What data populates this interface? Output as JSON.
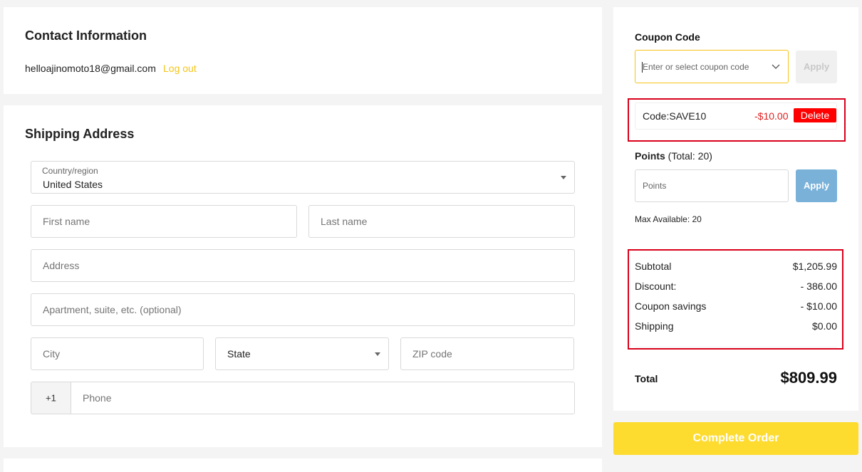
{
  "contact": {
    "title": "Contact Information",
    "email": "helloajinomoto18@gmail.com",
    "logout_label": "Log out"
  },
  "shipping": {
    "title": "Shipping Address",
    "country_label": "Country/region",
    "country_value": "United States",
    "first_name_placeholder": "First name",
    "last_name_placeholder": "Last name",
    "address_placeholder": "Address",
    "apartment_placeholder": "Apartment, suite, etc. (optional)",
    "city_placeholder": "City",
    "state_value": "State",
    "zip_placeholder": "ZIP code",
    "phone_prefix": "+1",
    "phone_placeholder": "Phone"
  },
  "coupon": {
    "title": "Coupon Code",
    "placeholder": "Enter or select coupon code",
    "apply_label": "Apply",
    "applied_code": "Code:SAVE10",
    "applied_amount": "-$10.00",
    "delete_label": "Delete"
  },
  "points": {
    "title": "Points",
    "total_text": "(Total: 20)",
    "placeholder": "Points",
    "apply_label": "Apply",
    "max_available": "Max Available: 20"
  },
  "summary": {
    "lines": [
      {
        "label": "Subtotal",
        "amount": "$1,205.99"
      },
      {
        "label": "Discount:",
        "amount": "- 386.00"
      },
      {
        "label": "Coupon savings",
        "amount": "- $10.00"
      },
      {
        "label": "Shipping",
        "amount": "$0.00"
      }
    ],
    "total_label": "Total",
    "total_amount": "$809.99"
  },
  "complete_order_label": "Complete Order",
  "colors": {
    "accent_yellow": "#fddb2f",
    "link_yellow": "#f5c518",
    "delete_red": "#ff0000",
    "apply_blue": "#7ab1d9",
    "highlight_red": "#d9001b"
  }
}
